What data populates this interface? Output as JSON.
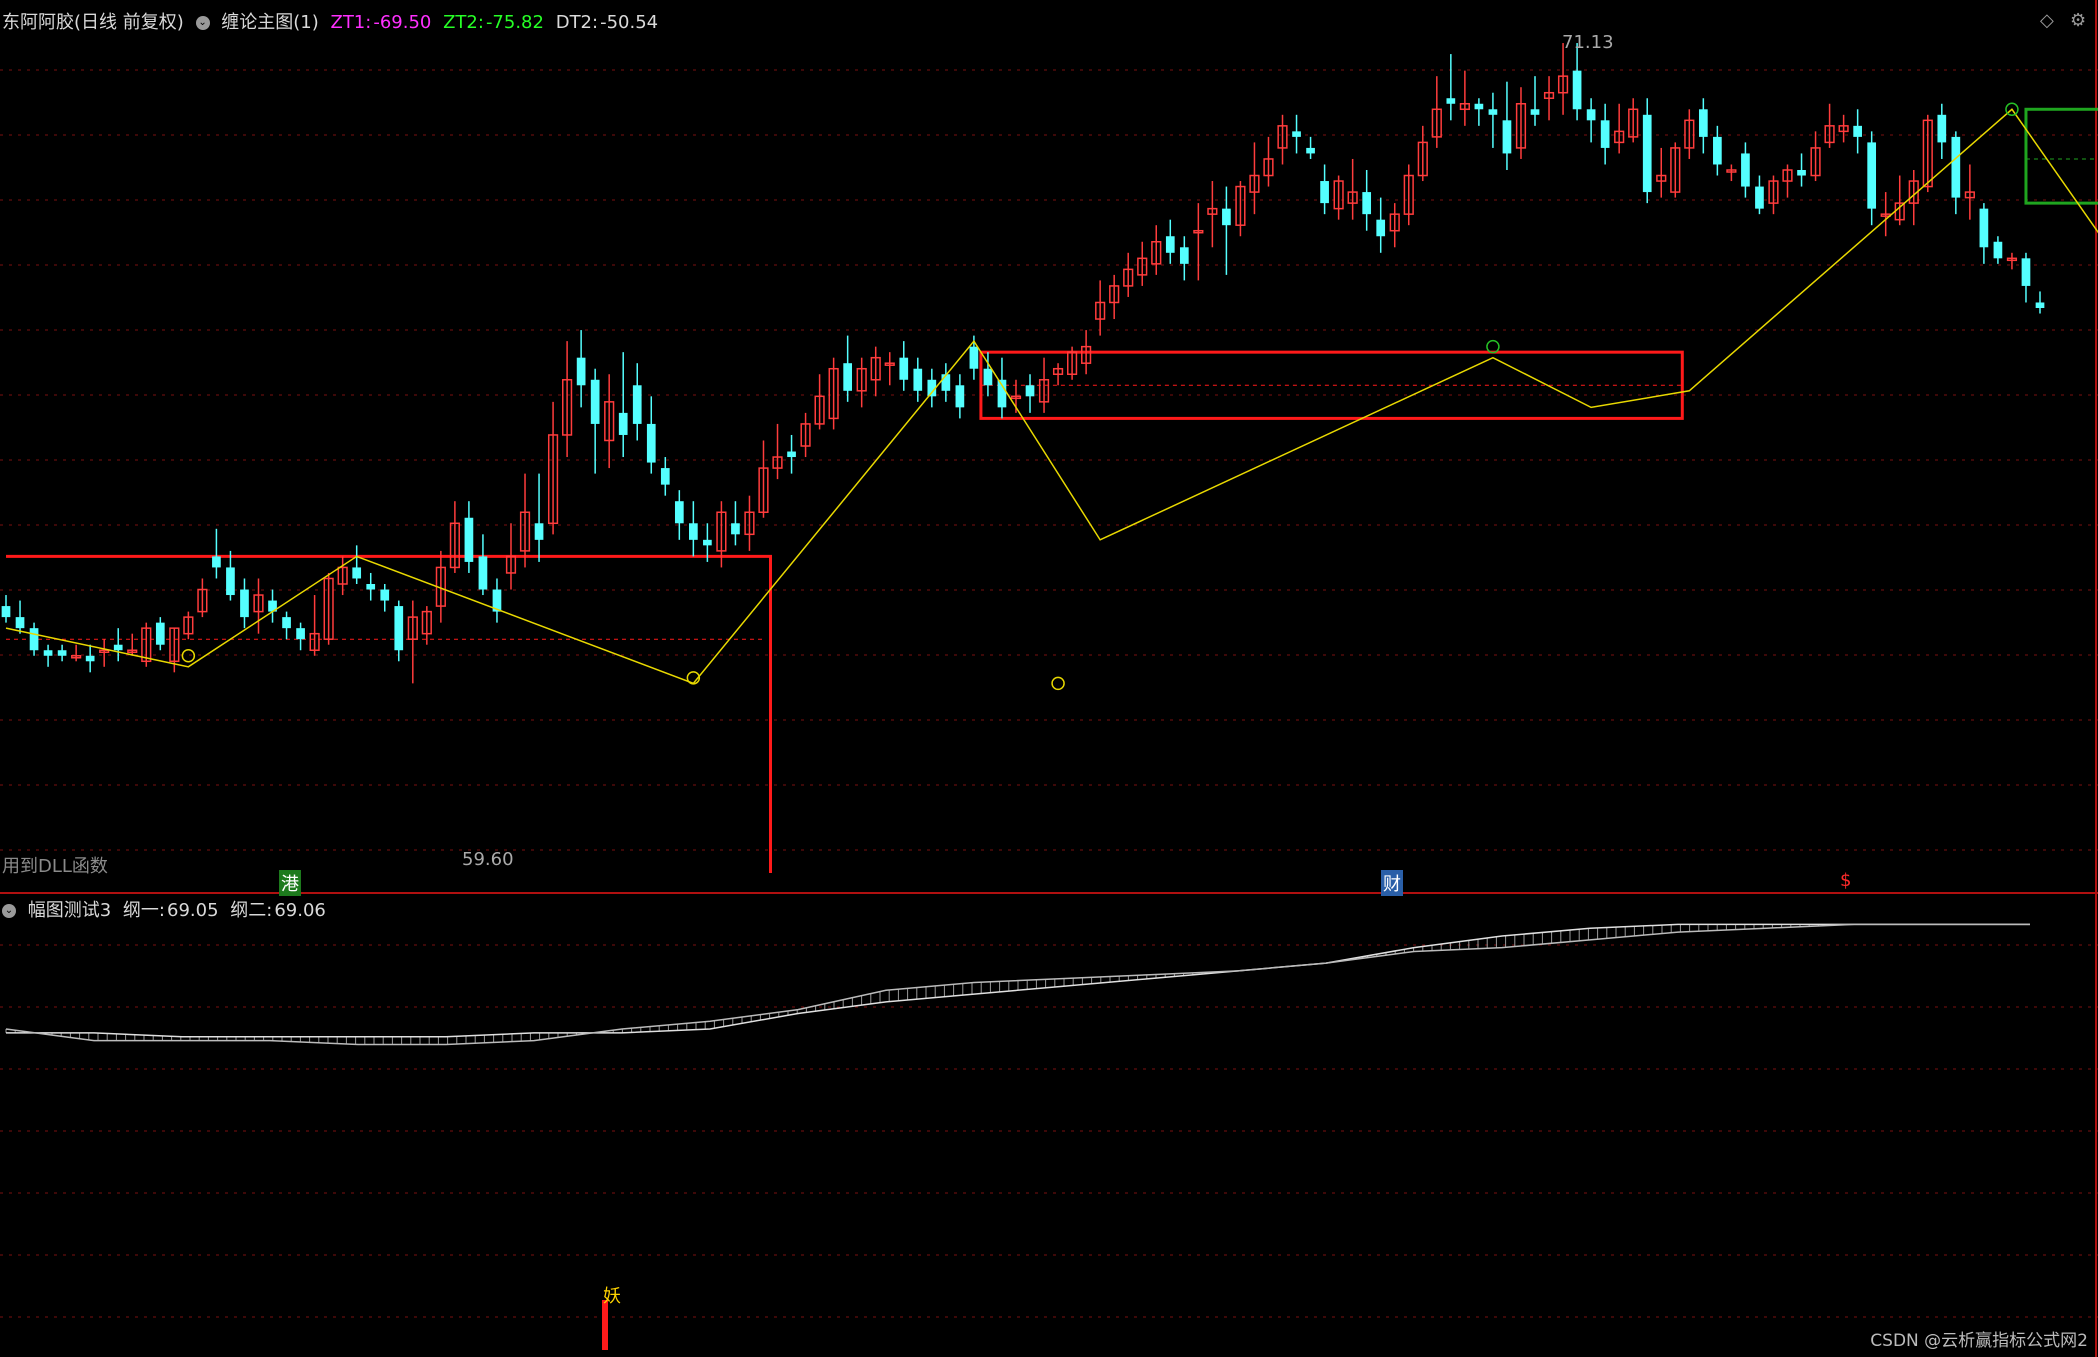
{
  "main_header": {
    "symbol": "东阿阿胶(日线 前复权)",
    "indicator": "缠论主图(1)",
    "zt1_label": "ZT1:",
    "zt1_value": "-69.50",
    "zt2_label": "ZT2:",
    "zt2_value": "-75.82",
    "dt2_label": "DT2:",
    "dt2_value": "-50.54"
  },
  "sub_header": {
    "indicator": "幅图测试3",
    "line1_label": "纲一:",
    "line1_value": "69.05",
    "line2_label": "纲二:",
    "line2_value": "69.06"
  },
  "dll_note": "用到DLL函数",
  "markers": {
    "high_label": "71.13",
    "low_label": "59.60",
    "gang": "港",
    "cai": "财",
    "dollar": "$",
    "yao": "妖"
  },
  "watermark": "CSDN @云析赢指标公式网2",
  "icons": [
    "collapse-circle-icon",
    "diamond-icon",
    "gear-icon"
  ],
  "colors": {
    "up": "#ff3c3c",
    "down": "#54ffff",
    "zigzag": "#e8d800",
    "box_red": "#ff1a1a",
    "box_green": "#1fa51f",
    "grid": "#7a1010"
  },
  "chart_data": {
    "type": "candlestick",
    "y_range": [
      57.5,
      72.5
    ],
    "candles": [
      [
        62.1,
        62.3,
        61.9,
        61.8
      ],
      [
        61.9,
        62.2,
        61.7,
        61.6
      ],
      [
        61.7,
        61.8,
        61.3,
        61.2
      ],
      [
        61.3,
        61.4,
        61.2,
        61.0
      ],
      [
        61.3,
        61.4,
        61.2,
        61.1
      ],
      [
        61.2,
        61.4,
        61.2,
        61.1
      ],
      [
        61.2,
        61.4,
        61.1,
        60.9
      ],
      [
        61.3,
        61.5,
        61.3,
        61.0
      ],
      [
        61.4,
        61.7,
        61.3,
        61.1
      ],
      [
        61.3,
        61.6,
        61.3,
        61.2
      ],
      [
        61.1,
        61.8,
        61.7,
        61.0
      ],
      [
        61.8,
        61.9,
        61.4,
        61.3
      ],
      [
        61.1,
        61.7,
        61.7,
        60.9
      ],
      [
        61.6,
        62.0,
        61.9,
        61.5
      ],
      [
        62.0,
        62.6,
        62.4,
        61.9
      ],
      [
        63.0,
        63.5,
        62.8,
        62.6
      ],
      [
        62.8,
        63.1,
        62.3,
        62.2
      ],
      [
        62.4,
        62.6,
        61.9,
        61.7
      ],
      [
        62.0,
        62.6,
        62.3,
        61.6
      ],
      [
        62.2,
        62.4,
        62.0,
        61.8
      ],
      [
        61.9,
        62.0,
        61.7,
        61.5
      ],
      [
        61.7,
        61.8,
        61.5,
        61.3
      ],
      [
        61.3,
        62.3,
        61.6,
        61.2
      ],
      [
        61.5,
        62.7,
        62.6,
        61.4
      ],
      [
        62.5,
        63.0,
        62.8,
        62.3
      ],
      [
        62.8,
        63.2,
        62.6,
        62.5
      ],
      [
        62.5,
        62.7,
        62.4,
        62.2
      ],
      [
        62.4,
        62.5,
        62.2,
        62.0
      ],
      [
        62.1,
        62.2,
        61.3,
        61.1
      ],
      [
        61.5,
        62.2,
        61.9,
        60.7
      ],
      [
        61.6,
        62.1,
        62.0,
        61.4
      ],
      [
        62.1,
        63.1,
        62.8,
        61.8
      ],
      [
        62.8,
        64.0,
        63.6,
        62.7
      ],
      [
        63.7,
        64.0,
        62.9,
        62.7
      ],
      [
        63.0,
        63.4,
        62.4,
        62.3
      ],
      [
        62.4,
        62.6,
        62.0,
        61.8
      ],
      [
        62.7,
        63.6,
        63.0,
        62.4
      ],
      [
        63.1,
        64.5,
        63.8,
        62.8
      ],
      [
        63.6,
        64.5,
        63.3,
        62.9
      ],
      [
        63.6,
        65.8,
        65.2,
        63.4
      ],
      [
        65.2,
        66.9,
        66.2,
        64.8
      ],
      [
        66.6,
        67.1,
        66.1,
        65.7
      ],
      [
        66.2,
        66.4,
        65.4,
        64.5
      ],
      [
        65.1,
        66.3,
        65.8,
        64.6
      ],
      [
        65.6,
        66.7,
        65.2,
        64.8
      ],
      [
        66.1,
        66.5,
        65.4,
        65.1
      ],
      [
        65.4,
        65.9,
        64.7,
        64.5
      ],
      [
        64.6,
        64.8,
        64.3,
        64.1
      ],
      [
        64.0,
        64.2,
        63.6,
        63.3
      ],
      [
        63.6,
        64.0,
        63.3,
        63.0
      ],
      [
        63.3,
        63.6,
        63.2,
        62.9
      ],
      [
        63.1,
        64.0,
        63.8,
        62.8
      ],
      [
        63.6,
        64.0,
        63.4,
        63.2
      ],
      [
        63.4,
        64.1,
        63.8,
        63.1
      ],
      [
        63.8,
        65.1,
        64.6,
        63.7
      ],
      [
        64.6,
        65.4,
        64.8,
        64.4
      ],
      [
        64.9,
        65.2,
        64.8,
        64.5
      ],
      [
        65.0,
        65.6,
        65.4,
        64.8
      ],
      [
        65.4,
        66.3,
        65.9,
        65.3
      ],
      [
        65.5,
        66.6,
        66.4,
        65.3
      ],
      [
        66.5,
        67.0,
        66.0,
        65.8
      ],
      [
        66.0,
        66.6,
        66.4,
        65.7
      ],
      [
        66.2,
        66.8,
        66.6,
        65.9
      ],
      [
        66.5,
        66.7,
        66.5,
        66.1
      ],
      [
        66.6,
        66.9,
        66.2,
        66.0
      ],
      [
        66.4,
        66.6,
        66.0,
        65.8
      ],
      [
        66.2,
        66.4,
        65.9,
        65.7
      ],
      [
        66.3,
        66.5,
        66.0,
        65.8
      ],
      [
        66.1,
        66.3,
        65.7,
        65.5
      ],
      [
        66.8,
        67.0,
        66.4,
        66.2
      ],
      [
        66.4,
        66.7,
        66.1,
        65.9
      ],
      [
        66.2,
        66.6,
        65.7,
        65.5
      ],
      [
        65.9,
        66.2,
        65.9,
        65.6
      ],
      [
        66.1,
        66.3,
        65.9,
        65.6
      ],
      [
        65.8,
        66.6,
        66.2,
        65.6
      ],
      [
        66.3,
        66.5,
        66.4,
        66.1
      ],
      [
        66.3,
        66.8,
        66.7,
        66.2
      ],
      [
        66.5,
        67.1,
        66.8,
        66.3
      ],
      [
        67.3,
        68.0,
        67.6,
        67.0
      ],
      [
        67.6,
        68.1,
        67.9,
        67.3
      ],
      [
        67.9,
        68.5,
        68.2,
        67.7
      ],
      [
        68.1,
        68.7,
        68.4,
        67.9
      ],
      [
        68.3,
        69.0,
        68.7,
        68.1
      ],
      [
        68.8,
        69.1,
        68.5,
        68.3
      ],
      [
        68.6,
        68.8,
        68.3,
        68.0
      ],
      [
        68.9,
        69.4,
        68.9,
        68.0
      ],
      [
        69.2,
        69.8,
        69.3,
        68.6
      ],
      [
        69.3,
        69.7,
        69.0,
        68.1
      ],
      [
        69.0,
        69.8,
        69.7,
        68.8
      ],
      [
        69.6,
        70.5,
        69.9,
        69.2
      ],
      [
        69.9,
        70.6,
        70.2,
        69.7
      ],
      [
        70.4,
        71.0,
        70.8,
        70.1
      ],
      [
        70.7,
        71.0,
        70.6,
        70.3
      ],
      [
        70.4,
        70.6,
        70.3,
        70.2
      ],
      [
        69.8,
        70.1,
        69.4,
        69.2
      ],
      [
        69.3,
        69.9,
        69.8,
        69.1
      ],
      [
        69.4,
        70.2,
        69.6,
        69.1
      ],
      [
        69.6,
        70.0,
        69.2,
        68.9
      ],
      [
        69.1,
        69.5,
        68.8,
        68.5
      ],
      [
        68.9,
        69.4,
        69.2,
        68.6
      ],
      [
        69.2,
        70.1,
        69.9,
        69.0
      ],
      [
        69.9,
        70.8,
        70.5,
        69.8
      ],
      [
        70.6,
        71.7,
        71.1,
        70.4
      ],
      [
        71.3,
        72.1,
        71.2,
        70.9
      ],
      [
        71.1,
        71.8,
        71.2,
        70.8
      ],
      [
        71.2,
        71.3,
        71.1,
        70.8
      ],
      [
        71.1,
        71.4,
        71.0,
        70.4
      ],
      [
        70.9,
        71.6,
        70.3,
        70.0
      ],
      [
        70.4,
        71.5,
        71.2,
        70.2
      ],
      [
        71.1,
        71.7,
        71.0,
        70.8
      ],
      [
        71.3,
        71.7,
        71.4,
        70.9
      ],
      [
        71.4,
        72.3,
        71.7,
        71.0
      ],
      [
        71.8,
        72.3,
        71.1,
        70.9
      ],
      [
        71.1,
        71.3,
        70.9,
        70.5
      ],
      [
        70.9,
        71.2,
        70.4,
        70.1
      ],
      [
        70.5,
        71.2,
        70.7,
        70.3
      ],
      [
        70.6,
        71.3,
        71.1,
        70.5
      ],
      [
        71.0,
        71.3,
        69.6,
        69.4
      ],
      [
        69.8,
        70.4,
        69.9,
        69.5
      ],
      [
        69.6,
        70.5,
        70.4,
        69.5
      ],
      [
        70.4,
        71.1,
        70.9,
        70.2
      ],
      [
        71.1,
        71.3,
        70.6,
        70.3
      ],
      [
        70.6,
        70.8,
        70.1,
        69.9
      ],
      [
        70.0,
        70.1,
        70.0,
        69.8
      ],
      [
        70.3,
        70.5,
        69.7,
        69.5
      ],
      [
        69.7,
        69.9,
        69.3,
        69.2
      ],
      [
        69.4,
        69.9,
        69.8,
        69.2
      ],
      [
        69.8,
        70.1,
        70.0,
        69.5
      ],
      [
        70.0,
        70.3,
        69.9,
        69.7
      ],
      [
        69.9,
        70.7,
        70.4,
        69.8
      ],
      [
        70.5,
        71.2,
        70.8,
        70.4
      ],
      [
        70.7,
        71.0,
        70.8,
        70.5
      ],
      [
        70.8,
        71.1,
        70.6,
        70.3
      ],
      [
        70.5,
        70.7,
        69.3,
        69.0
      ],
      [
        69.2,
        69.6,
        69.2,
        68.8
      ],
      [
        69.1,
        69.9,
        69.4,
        69.0
      ],
      [
        69.4,
        70.0,
        69.8,
        69.0
      ],
      [
        69.7,
        71.0,
        70.9,
        69.6
      ],
      [
        71.0,
        71.2,
        70.5,
        70.2
      ],
      [
        70.6,
        70.7,
        69.5,
        69.2
      ],
      [
        69.5,
        70.1,
        69.6,
        69.1
      ],
      [
        69.3,
        69.4,
        68.6,
        68.3
      ],
      [
        68.7,
        68.8,
        68.4,
        68.3
      ],
      [
        68.4,
        68.5,
        68.4,
        68.2
      ],
      [
        68.4,
        68.5,
        67.9,
        67.6
      ],
      [
        67.6,
        67.8,
        67.5,
        67.4
      ]
    ],
    "zigzag": [
      [
        0,
        61.7
      ],
      [
        13,
        61.0
      ],
      [
        25,
        63.0
      ],
      [
        49,
        60.7
      ],
      [
        69,
        66.9
      ],
      [
        78,
        63.3
      ],
      [
        106,
        66.6
      ],
      [
        113,
        65.7
      ],
      [
        120,
        66.0
      ],
      [
        143,
        71.1
      ],
      [
        151,
        68.2
      ],
      [
        167,
        72.3
      ],
      [
        175,
        71.0
      ],
      [
        189,
        69.3
      ],
      [
        196,
        70.9
      ],
      [
        203,
        70.3
      ],
      [
        215,
        68.2
      ]
    ],
    "boxes": [
      {
        "color": "red",
        "x0": 69.5,
        "x1": 119.5,
        "top": 66.7,
        "bottom": 65.5,
        "mid": 66.1
      },
      {
        "color": "green",
        "x0": 144,
        "x1": 212,
        "top": 71.1,
        "bottom": 69.4,
        "mid": 70.2
      }
    ],
    "sub": {
      "line1": [
        68.2,
        68.2,
        68.1,
        68.1,
        68.1,
        68.1,
        68.2,
        68.2,
        68.3,
        68.7,
        69.0,
        69.2,
        69.4,
        69.6,
        69.8,
        70.0,
        70.4,
        70.7,
        70.9,
        71.0,
        71.0,
        71.0,
        71.0,
        71.0
      ],
      "line2": [
        68.3,
        68.0,
        68.0,
        68.0,
        67.9,
        67.9,
        68.0,
        68.3,
        68.5,
        68.8,
        69.3,
        69.5,
        69.6,
        69.7,
        69.8,
        70.0,
        70.3,
        70.4,
        70.6,
        70.8,
        70.9,
        71.0,
        71.0,
        71.0
      ]
    }
  }
}
